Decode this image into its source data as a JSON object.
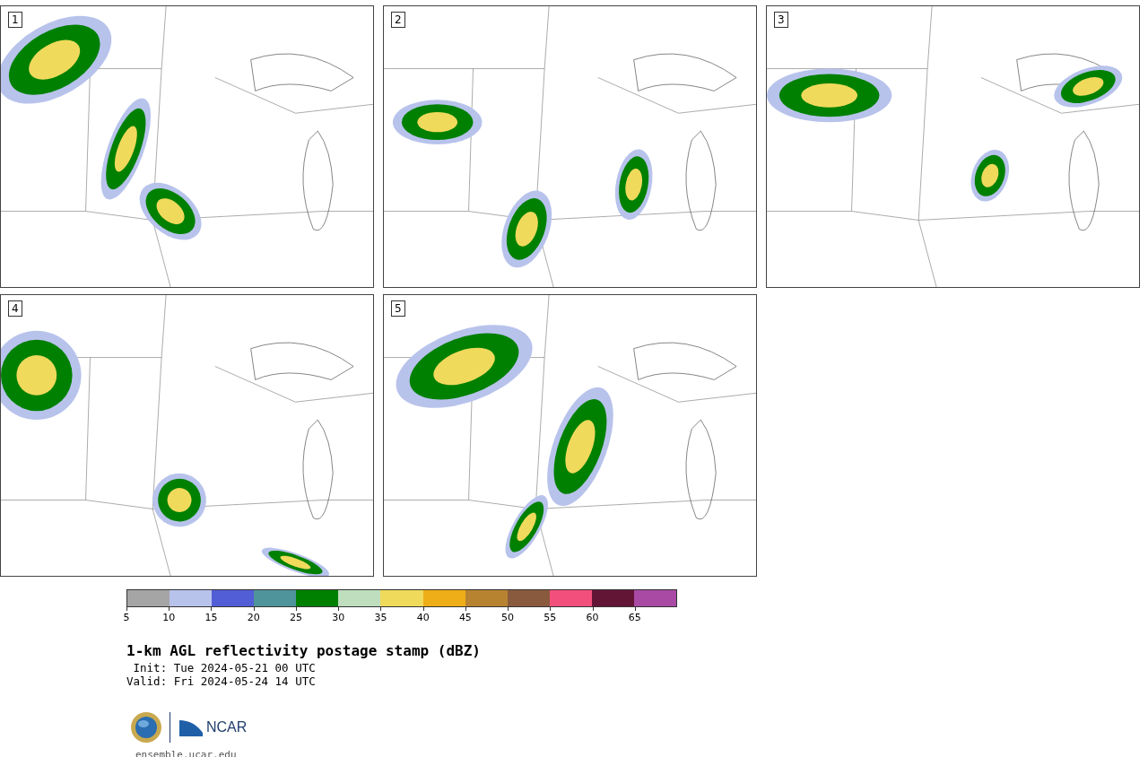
{
  "panels": [
    {
      "label": "1"
    },
    {
      "label": "2"
    },
    {
      "label": "3"
    },
    {
      "label": "4"
    },
    {
      "label": "5"
    }
  ],
  "colorbar": {
    "segments": [
      {
        "color": "#a5a5a5"
      },
      {
        "color": "#b8c3ec"
      },
      {
        "color": "#525ed6"
      },
      {
        "color": "#4f949b"
      },
      {
        "color": "#008000"
      },
      {
        "color": "#bedebe"
      },
      {
        "color": "#f0da5c"
      },
      {
        "color": "#eeae18"
      },
      {
        "color": "#b88330"
      },
      {
        "color": "#8a5a3e"
      },
      {
        "color": "#f34f7d"
      },
      {
        "color": "#631536"
      },
      {
        "color": "#a94aa5"
      }
    ],
    "ticks": [
      "5",
      "10",
      "15",
      "20",
      "25",
      "30",
      "35",
      "40",
      "45",
      "50",
      "55",
      "60",
      "65"
    ]
  },
  "title": "1-km AGL reflectivity postage stamp (dBZ)",
  "init": " Init: Tue 2024-05-21 00 UTC",
  "valid": "Valid: Fri 2024-05-24 14 UTC",
  "logo_text": "NCAR",
  "url": "ensemble.ucar.edu"
}
